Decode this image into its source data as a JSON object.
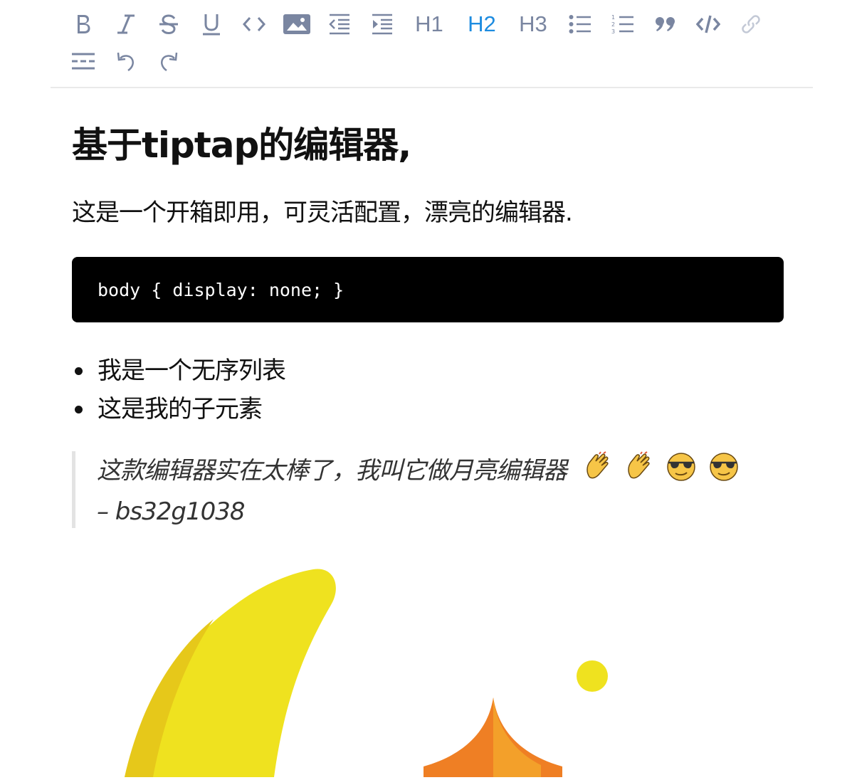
{
  "toolbar": {
    "buttons": [
      {
        "name": "bold",
        "icon": "bold-icon"
      },
      {
        "name": "italic",
        "icon": "italic-icon"
      },
      {
        "name": "strike",
        "icon": "strikethrough-icon"
      },
      {
        "name": "underline",
        "icon": "underline-icon"
      },
      {
        "name": "code",
        "icon": "code-icon"
      },
      {
        "name": "image",
        "icon": "image-icon"
      },
      {
        "name": "outdent",
        "icon": "outdent-icon"
      },
      {
        "name": "indent",
        "icon": "indent-icon"
      },
      {
        "name": "bullet-list",
        "icon": "bullet-list-icon"
      },
      {
        "name": "ordered-list",
        "icon": "ordered-list-icon"
      },
      {
        "name": "blockquote",
        "icon": "quote-icon"
      },
      {
        "name": "code-block",
        "icon": "code-block-icon"
      },
      {
        "name": "link",
        "icon": "link-icon"
      },
      {
        "name": "horizontal-rule",
        "icon": "horizontal-rule-icon"
      },
      {
        "name": "undo",
        "icon": "undo-icon"
      },
      {
        "name": "redo",
        "icon": "redo-icon"
      }
    ],
    "h1_label": "H1",
    "h2_label": "H2",
    "h3_label": "H3",
    "active_heading": "H2",
    "icon_color": "#7a86a1",
    "active_color": "#1d8ce0"
  },
  "editor": {
    "title": "基于tiptap的编辑器,",
    "paragraph": "这是一个开箱即用，可灵活配置，漂亮的编辑器.",
    "code": "body { display: none; }",
    "bullets": [
      "我是一个无序列表",
      "这是我的子元素"
    ],
    "quote_text": "这款编辑器实在太棒了，我叫它做月亮编辑器",
    "quote_emojis": [
      "clapping-hands-emoji",
      "clapping-hands-emoji",
      "sunglasses-face-emoji",
      "sunglasses-face-emoji"
    ],
    "quote_author": "– bs32g1038",
    "illustration": "moon-and-star-illustration"
  }
}
